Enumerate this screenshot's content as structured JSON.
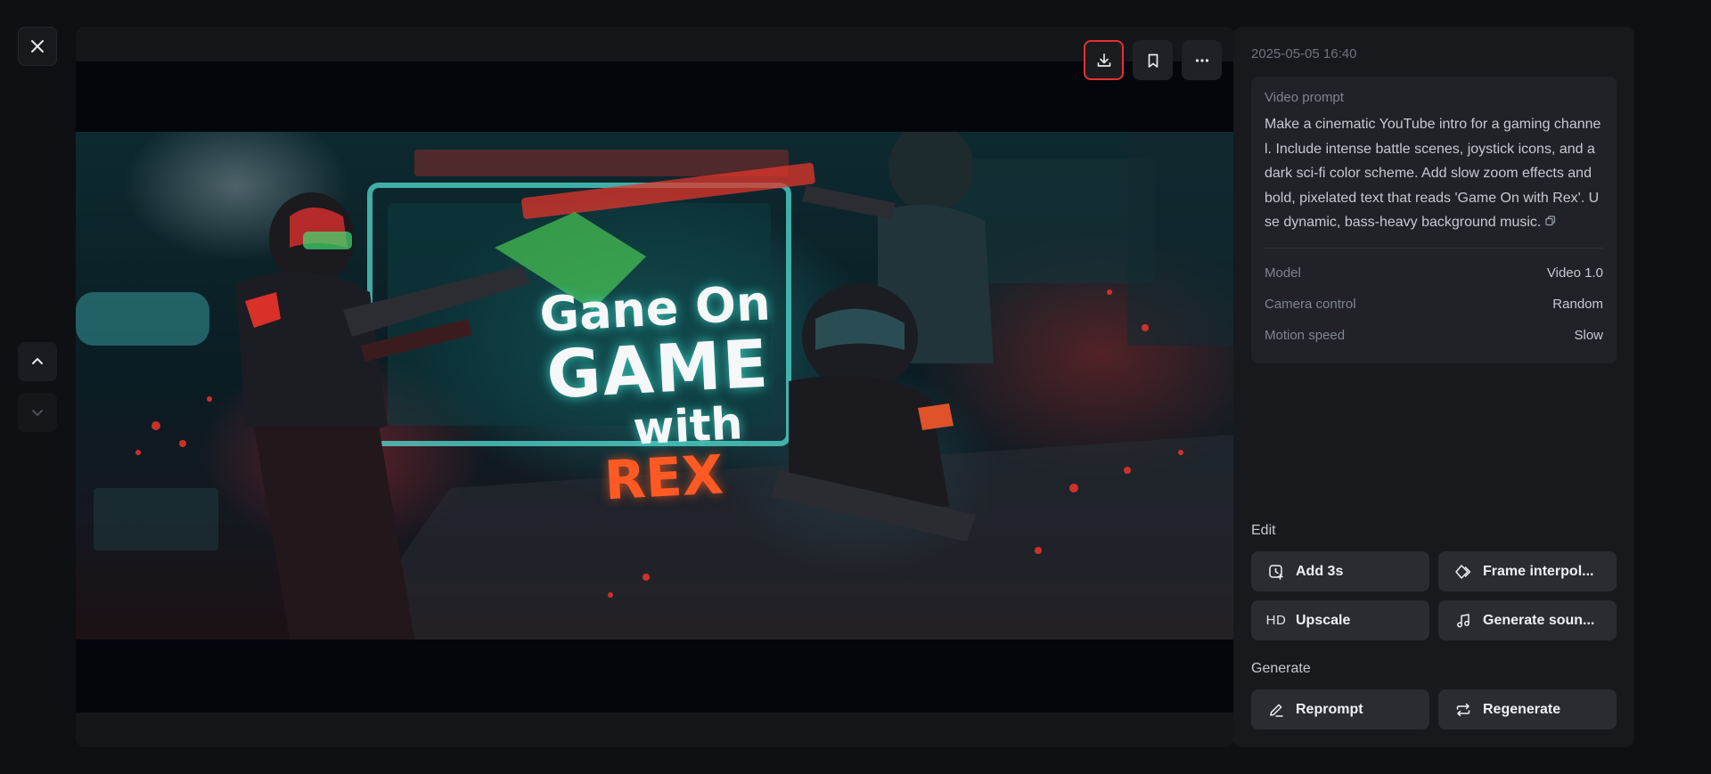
{
  "timestamp": "2025-05-05 16:40",
  "prompt": {
    "label": "Video prompt",
    "text": "Make a cinematic YouTube intro for a gaming channel. Include intense battle scenes, joystick icons, and a dark sci-fi color scheme. Add slow zoom effects and bold, pixelated text that reads 'Game On with Rex'. Use dynamic, bass-heavy background music."
  },
  "meta": [
    {
      "key": "Model",
      "value": "Video 1.0"
    },
    {
      "key": "Camera control",
      "value": "Random"
    },
    {
      "key": "Motion speed",
      "value": "Slow"
    }
  ],
  "edit": {
    "label": "Edit",
    "add3s": "Add 3s",
    "frame_interp": "Frame interpol...",
    "upscale_prefix": "HD",
    "upscale": "Upscale",
    "generate_sound": "Generate soun..."
  },
  "generate": {
    "label": "Generate",
    "reprompt": "Reprompt",
    "regenerate": "Regenerate"
  },
  "video_image": {
    "line1": "Gane On",
    "line2": "GAME",
    "line3": "with",
    "line4": "REX"
  },
  "colors": {
    "highlight": "#e5322d",
    "accent_teal": "#3fe0d0",
    "accent_red": "#e0342a",
    "accent_orange": "#ff6a2a"
  },
  "icons": {
    "close": "close-icon",
    "up": "chevron-up-icon",
    "down": "chevron-down-icon",
    "download": "download-icon",
    "bookmark": "bookmark-icon",
    "more": "more-icon"
  }
}
